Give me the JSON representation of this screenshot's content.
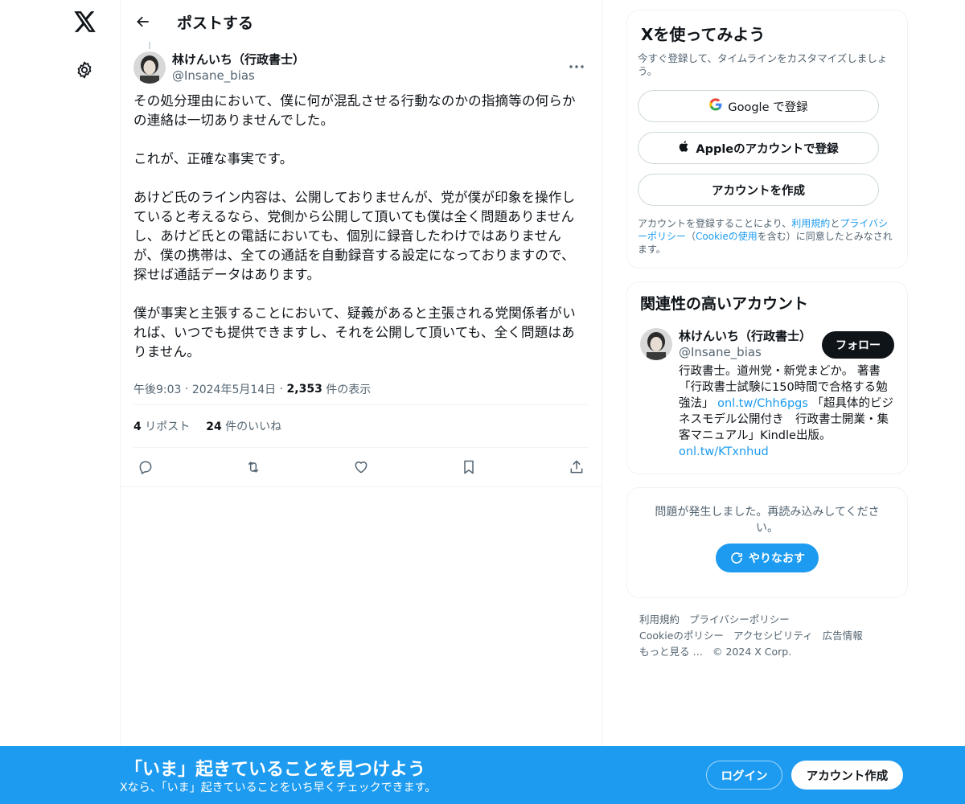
{
  "header": {
    "title": "ポストする"
  },
  "post": {
    "author_name": "林けんいち（行政書士）",
    "author_handle": "@Insane_bias",
    "body": "その処分理由において、僕に何が混乱させる行動なのかの指摘等の何らか\nの連絡は一切ありませんでした。\n\nこれが、正確な事実です。\n\nあけど氏のライン内容は、公開しておりませんが、党が僕が印象を操作し\nていると考えるなら、党側から公開して頂いても僕は全く問題ありません\nし、あけど氏との電話においても、個別に録音したわけではありません\nが、僕の携帯は、全ての通話を自動録音する設定になっておりますので、\n探せば通話データはあります。\n\n僕が事実と主張することにおいて、疑義があると主張される党関係者がい\nれば、いつでも提供できますし、それを公開して頂いても、全く問題はあ\nりません。",
    "time": "午後9:03",
    "date": "2024年5月14日",
    "views_count": "2,353",
    "views_label": "件の表示",
    "reposts_count": "4",
    "reposts_label": "リポスト",
    "likes_count": "24",
    "likes_label": "件のいいね"
  },
  "signup_card": {
    "title": "Xを使ってみよう",
    "subtitle": "今すぐ登録して、タイムラインをカスタマイズしましょう。",
    "google_label": "Google で登録",
    "apple_label": "Appleのアカウントで登録",
    "create_label": "アカウントを作成",
    "legal_prefix": "アカウントを登録することにより、",
    "legal_terms": "利用規約",
    "legal_and": "と",
    "legal_privacy": "プライバシーポリシー",
    "legal_paren_open": "（",
    "legal_cookie": "Cookieの使用",
    "legal_suffix": "を含む）に同意したとみなされます。"
  },
  "related": {
    "title": "関連性の高いアカウント",
    "name": "林けんいち（行政書士）",
    "handle": "@Insane_bias",
    "follow_label": "フォロー",
    "bio_part1": "行政書士。道州党・新党まどか。 著書「行政書士試験に150時間で合格する勉強法」 ",
    "bio_link1": "onl.tw/Chh6pgs",
    "bio_part2": " 「超具体的ビジネスモデル公開付き　行政書士開業・集客マニュアル」Kindle出版。 ",
    "bio_link2": "onl.tw/KTxnhud"
  },
  "error_card": {
    "message": "問題が発生しました。再読み込みしてください。",
    "retry_label": "やりなおす"
  },
  "footer": {
    "terms": "利用規約",
    "privacy": "プライバシーポリシー",
    "cookie": "Cookieのポリシー",
    "accessibility": "アクセシビリティ",
    "ads": "広告情報",
    "more": "もっと見る …",
    "copyright": "© 2024 X Corp."
  },
  "bottom_bar": {
    "title": "「いま」起きていることを見つけよう",
    "subtitle": "Xなら、「いま」起きていることをいち早くチェックできます。",
    "login_label": "ログイン",
    "signup_label": "アカウント作成"
  },
  "colors": {
    "accent": "#1d9bf0",
    "text": "#0f1419",
    "muted": "#536471",
    "border": "#eff3f4"
  },
  "icons": [
    "x-logo-icon",
    "gear-icon",
    "back-arrow-icon",
    "more-icon",
    "reply-icon",
    "repost-icon",
    "like-icon",
    "bookmark-icon",
    "share-icon",
    "google-icon",
    "apple-icon",
    "refresh-icon"
  ]
}
